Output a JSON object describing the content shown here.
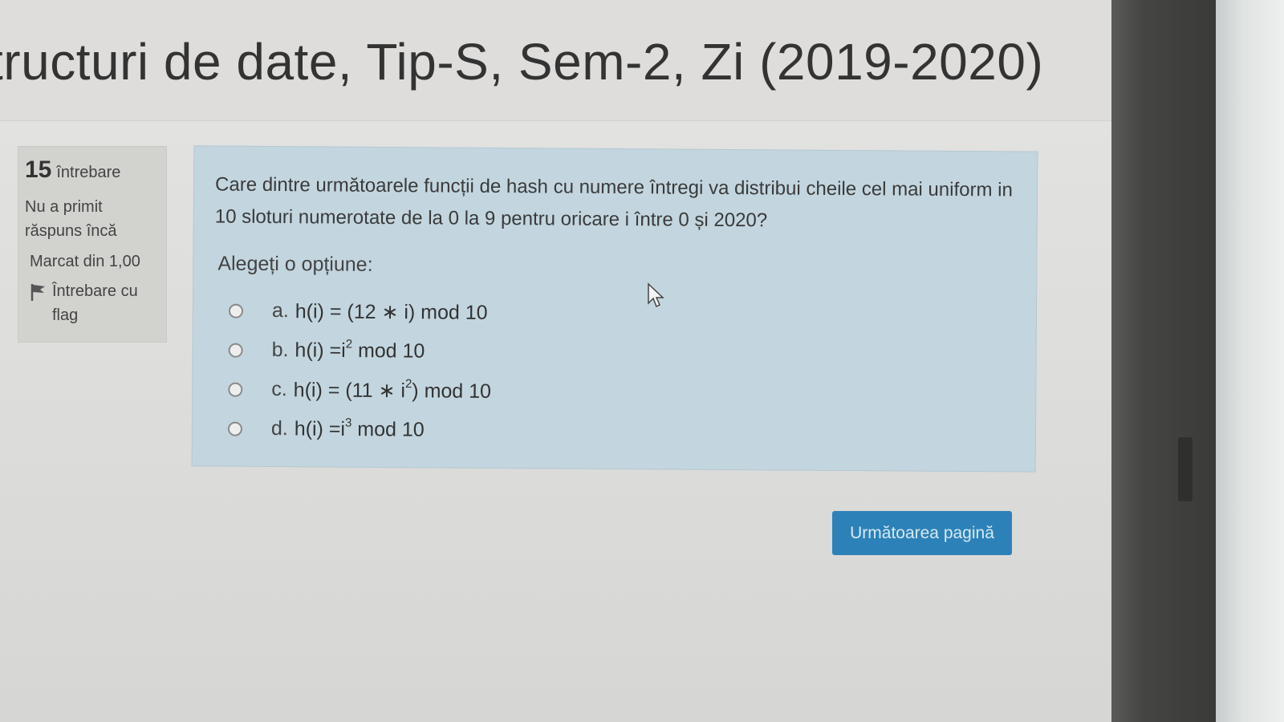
{
  "page": {
    "title": "tructuri de date, Tip-S, Sem-2, Zi (2019-2020)"
  },
  "info": {
    "number": "15",
    "number_label": "întrebare",
    "state": "Nu a primit răspuns încă",
    "grade": "Marcat din 1,00",
    "flag_label": "Întrebare cu flag",
    "flag_icon": "flag-icon"
  },
  "question": {
    "text": "Care dintre următoarele funcții de hash cu numere întregi va distribui cheile cel mai uniform in 10 sloturi numerotate de la 0 la 9 pentru oricare i între 0 și 2020?",
    "prompt": "Alegeți o opțiune:",
    "answers": [
      {
        "letter": "a.",
        "pre": "h(i) = (12 ∗ i) mod 10",
        "exp": "",
        "post": ""
      },
      {
        "letter": "b.",
        "pre": "h(i) =i",
        "exp": "2",
        "post": " mod 10"
      },
      {
        "letter": "c.",
        "pre": "h(i) = (11 ∗ i",
        "exp": "2",
        "post": ") mod 10"
      },
      {
        "letter": "d.",
        "pre": "h(i) =i",
        "exp": "3",
        "post": " mod 10"
      }
    ]
  },
  "navigation": {
    "next_label": "Următoarea pagină"
  },
  "colors": {
    "question_bg": "#c3d6df",
    "button_bg": "#2c82b8",
    "info_bg": "#d2d2cf"
  }
}
